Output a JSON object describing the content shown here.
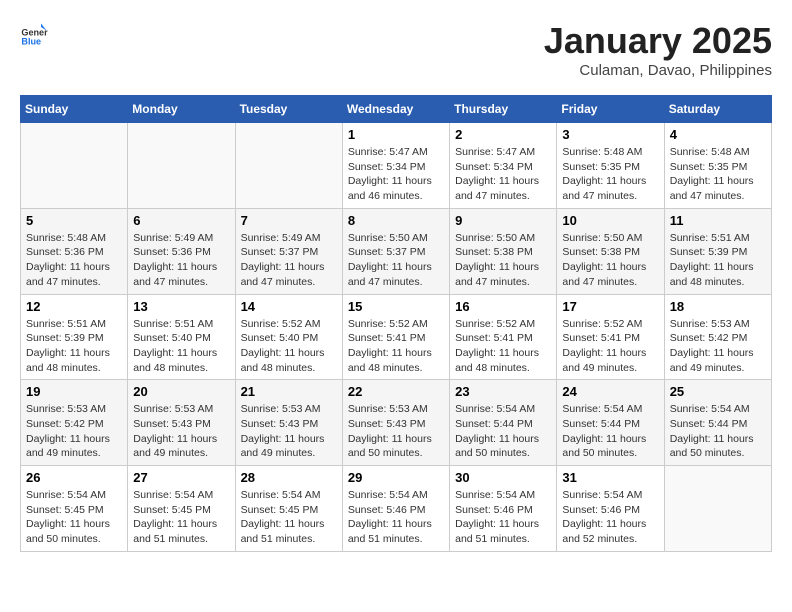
{
  "header": {
    "logo_line1": "General",
    "logo_line2": "Blue",
    "month": "January 2025",
    "location": "Culaman, Davao, Philippines"
  },
  "weekdays": [
    "Sunday",
    "Monday",
    "Tuesday",
    "Wednesday",
    "Thursday",
    "Friday",
    "Saturday"
  ],
  "weeks": [
    [
      {
        "day": "",
        "info": ""
      },
      {
        "day": "",
        "info": ""
      },
      {
        "day": "",
        "info": ""
      },
      {
        "day": "1",
        "info": "Sunrise: 5:47 AM\nSunset: 5:34 PM\nDaylight: 11 hours and 46 minutes."
      },
      {
        "day": "2",
        "info": "Sunrise: 5:47 AM\nSunset: 5:34 PM\nDaylight: 11 hours and 47 minutes."
      },
      {
        "day": "3",
        "info": "Sunrise: 5:48 AM\nSunset: 5:35 PM\nDaylight: 11 hours and 47 minutes."
      },
      {
        "day": "4",
        "info": "Sunrise: 5:48 AM\nSunset: 5:35 PM\nDaylight: 11 hours and 47 minutes."
      }
    ],
    [
      {
        "day": "5",
        "info": "Sunrise: 5:48 AM\nSunset: 5:36 PM\nDaylight: 11 hours and 47 minutes."
      },
      {
        "day": "6",
        "info": "Sunrise: 5:49 AM\nSunset: 5:36 PM\nDaylight: 11 hours and 47 minutes."
      },
      {
        "day": "7",
        "info": "Sunrise: 5:49 AM\nSunset: 5:37 PM\nDaylight: 11 hours and 47 minutes."
      },
      {
        "day": "8",
        "info": "Sunrise: 5:50 AM\nSunset: 5:37 PM\nDaylight: 11 hours and 47 minutes."
      },
      {
        "day": "9",
        "info": "Sunrise: 5:50 AM\nSunset: 5:38 PM\nDaylight: 11 hours and 47 minutes."
      },
      {
        "day": "10",
        "info": "Sunrise: 5:50 AM\nSunset: 5:38 PM\nDaylight: 11 hours and 47 minutes."
      },
      {
        "day": "11",
        "info": "Sunrise: 5:51 AM\nSunset: 5:39 PM\nDaylight: 11 hours and 48 minutes."
      }
    ],
    [
      {
        "day": "12",
        "info": "Sunrise: 5:51 AM\nSunset: 5:39 PM\nDaylight: 11 hours and 48 minutes."
      },
      {
        "day": "13",
        "info": "Sunrise: 5:51 AM\nSunset: 5:40 PM\nDaylight: 11 hours and 48 minutes."
      },
      {
        "day": "14",
        "info": "Sunrise: 5:52 AM\nSunset: 5:40 PM\nDaylight: 11 hours and 48 minutes."
      },
      {
        "day": "15",
        "info": "Sunrise: 5:52 AM\nSunset: 5:41 PM\nDaylight: 11 hours and 48 minutes."
      },
      {
        "day": "16",
        "info": "Sunrise: 5:52 AM\nSunset: 5:41 PM\nDaylight: 11 hours and 48 minutes."
      },
      {
        "day": "17",
        "info": "Sunrise: 5:52 AM\nSunset: 5:41 PM\nDaylight: 11 hours and 49 minutes."
      },
      {
        "day": "18",
        "info": "Sunrise: 5:53 AM\nSunset: 5:42 PM\nDaylight: 11 hours and 49 minutes."
      }
    ],
    [
      {
        "day": "19",
        "info": "Sunrise: 5:53 AM\nSunset: 5:42 PM\nDaylight: 11 hours and 49 minutes."
      },
      {
        "day": "20",
        "info": "Sunrise: 5:53 AM\nSunset: 5:43 PM\nDaylight: 11 hours and 49 minutes."
      },
      {
        "day": "21",
        "info": "Sunrise: 5:53 AM\nSunset: 5:43 PM\nDaylight: 11 hours and 49 minutes."
      },
      {
        "day": "22",
        "info": "Sunrise: 5:53 AM\nSunset: 5:43 PM\nDaylight: 11 hours and 50 minutes."
      },
      {
        "day": "23",
        "info": "Sunrise: 5:54 AM\nSunset: 5:44 PM\nDaylight: 11 hours and 50 minutes."
      },
      {
        "day": "24",
        "info": "Sunrise: 5:54 AM\nSunset: 5:44 PM\nDaylight: 11 hours and 50 minutes."
      },
      {
        "day": "25",
        "info": "Sunrise: 5:54 AM\nSunset: 5:44 PM\nDaylight: 11 hours and 50 minutes."
      }
    ],
    [
      {
        "day": "26",
        "info": "Sunrise: 5:54 AM\nSunset: 5:45 PM\nDaylight: 11 hours and 50 minutes."
      },
      {
        "day": "27",
        "info": "Sunrise: 5:54 AM\nSunset: 5:45 PM\nDaylight: 11 hours and 51 minutes."
      },
      {
        "day": "28",
        "info": "Sunrise: 5:54 AM\nSunset: 5:45 PM\nDaylight: 11 hours and 51 minutes."
      },
      {
        "day": "29",
        "info": "Sunrise: 5:54 AM\nSunset: 5:46 PM\nDaylight: 11 hours and 51 minutes."
      },
      {
        "day": "30",
        "info": "Sunrise: 5:54 AM\nSunset: 5:46 PM\nDaylight: 11 hours and 51 minutes."
      },
      {
        "day": "31",
        "info": "Sunrise: 5:54 AM\nSunset: 5:46 PM\nDaylight: 11 hours and 52 minutes."
      },
      {
        "day": "",
        "info": ""
      }
    ]
  ]
}
